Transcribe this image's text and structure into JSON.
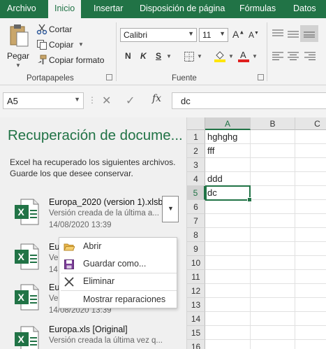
{
  "ribbon_tabs": [
    {
      "label": "Archivo"
    },
    {
      "label": "Inicio"
    },
    {
      "label": "Insertar"
    },
    {
      "label": "Disposición de página"
    },
    {
      "label": "Fórmulas"
    },
    {
      "label": "Datos"
    }
  ],
  "clipboard": {
    "paste": "Pegar",
    "cut": "Cortar",
    "copy": "Copiar",
    "format_painter": "Copiar formato",
    "group": "Portapapeles"
  },
  "font": {
    "name": "Calibri",
    "size": "11",
    "bold": "N",
    "italic": "K",
    "underline": "S",
    "group": "Fuente",
    "fill_color": "#ffe600",
    "text_color": "#e0201f"
  },
  "formula_bar": {
    "name_box": "A5",
    "fx": "fx",
    "content": "dc"
  },
  "recovery": {
    "title": "Recuperación de docume...",
    "description": "Excel ha recuperado los siguientes archivos. Guarde los que desee conservar.",
    "files": [
      {
        "name": "Europa_2020 (version 1).xlsb...",
        "version": "Versión creada de la última a...",
        "date": "14/08/2020 13:39"
      },
      {
        "name": "Eu",
        "version": "Ve",
        "date": "14"
      },
      {
        "name": "Eu",
        "version": "Ve",
        "date": "14/08/2020 13:39"
      },
      {
        "name": "Europa.xls  [Original]",
        "version": "Versión creada la última vez q...",
        "date": ""
      }
    ]
  },
  "context_menu": {
    "items": [
      {
        "label": "Abrir",
        "icon": "folder-open-icon"
      },
      {
        "label": "Guardar como...",
        "icon": "save-icon"
      },
      {
        "label": "Eliminar",
        "icon": "close-icon"
      },
      {
        "label": "Mostrar reparaciones",
        "icon": ""
      }
    ]
  },
  "sheet": {
    "columns": [
      "A",
      "B",
      "C"
    ],
    "rows": [
      "1",
      "2",
      "3",
      "4",
      "5",
      "6",
      "7",
      "8",
      "9",
      "10",
      "11",
      "12",
      "13",
      "14",
      "15",
      "16"
    ],
    "cells": {
      "A1": "hghghg",
      "A2": "fff",
      "A4": "ddd",
      "A5": "dc"
    },
    "accent": "#217346"
  }
}
